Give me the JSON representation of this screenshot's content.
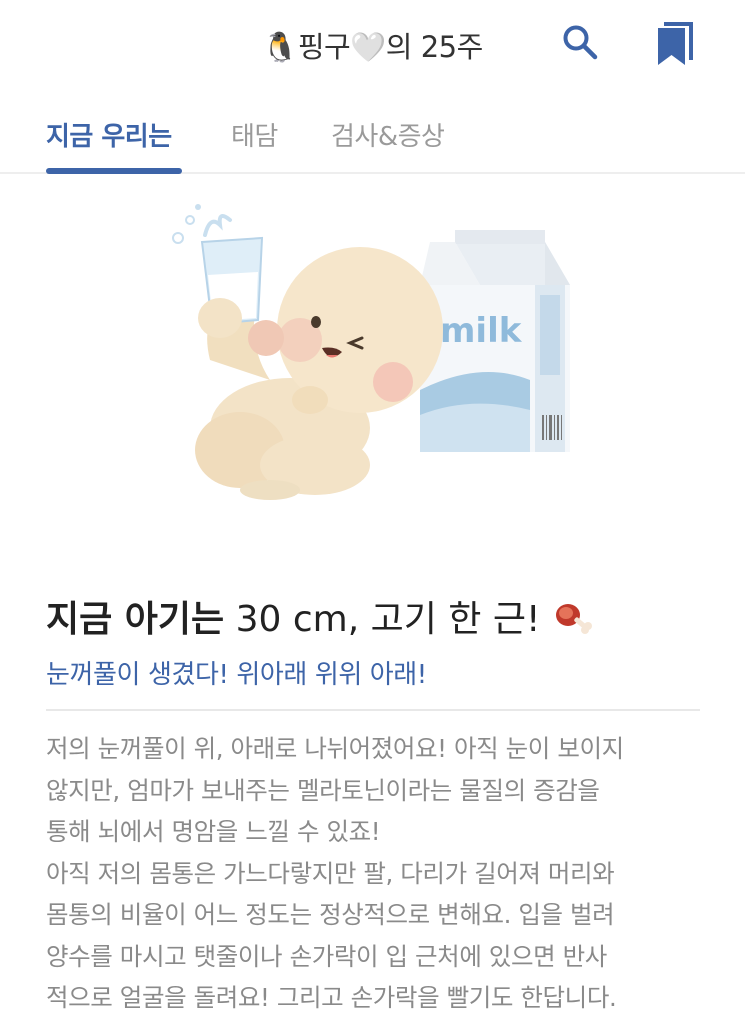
{
  "header": {
    "title": "🐧핑구🤍의 25주",
    "search_icon": "search-icon",
    "bookmark_icon": "bookmark-icon",
    "accent_color": "#3d64a8"
  },
  "tabs": [
    {
      "label": "지금 우리는",
      "active": true
    },
    {
      "label": "태담",
      "active": false
    },
    {
      "label": "검사&증상",
      "active": false
    }
  ],
  "illustration": {
    "carton_label": "milk"
  },
  "content": {
    "heading_strong": "지금 아기는",
    "heading_rest": "30 cm, 고기 한 근!",
    "heading_icon": "meat-on-bone-icon",
    "subheading": "눈꺼풀이 생겼다! 위아래 위위 아래!",
    "body_lines": [
      "저의 눈꺼풀이 위, 아래로 나뉘어졌어요! 아직 눈이 보이지",
      "않지만, 엄마가 보내주는 멜라토닌이라는 물질의 증감을",
      "통해 뇌에서 명암을 느낄 수 있죠!",
      "아직 저의 몸통은 가느다랗지만 팔, 다리가 길어져 머리와",
      "몸통의 비율이 어느 정도는 정상적으로 변해요. 입을 벌려",
      "양수를 마시고 탯줄이나 손가락이 입 근처에 있으면 반사",
      "적으로 얼굴을 돌려요! 그리고 손가락을 빨기도 한답니다."
    ]
  }
}
